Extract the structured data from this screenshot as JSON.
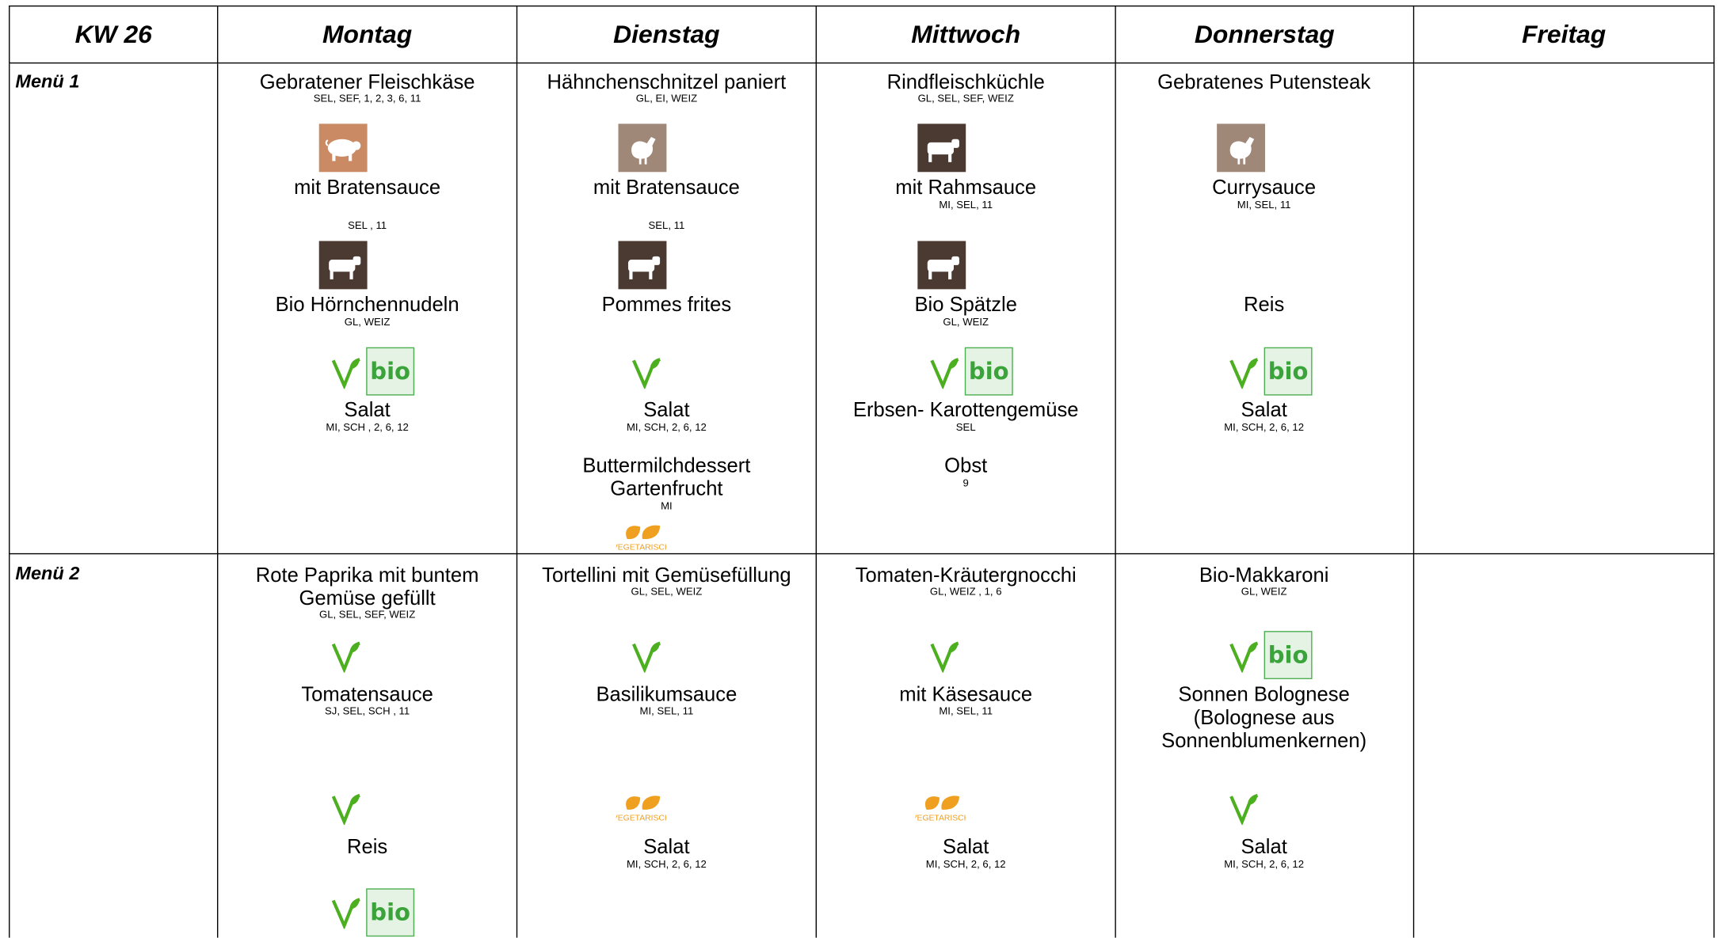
{
  "header": {
    "week": "KW 26",
    "days": [
      "Montag",
      "Dienstag",
      "Mittwoch",
      "Donnerstag",
      "Freitag"
    ]
  },
  "menus": [
    {
      "label": "Menü 1",
      "days": [
        {
          "items": [
            {
              "name": "Gebratener Fleischkäse",
              "allergens": "SEL, SEF, 1, 2, 3, 6, 11"
            },
            {
              "name": "mit Bratensauce",
              "allergens": "SEL , 11"
            },
            {
              "name": "Bio Hörnchennudeln",
              "allergens": "GL, WEIZ"
            },
            {
              "name": "Salat",
              "allergens": "MI, SCH , 2, 6, 12"
            }
          ],
          "icons": [
            "pig-icon",
            "cow-icon",
            "vegan-leaf-icon",
            "bio-badge-icon"
          ]
        },
        {
          "items": [
            {
              "name": "Hähnchenschnitzel paniert",
              "allergens": "GL, EI, WEIZ"
            },
            {
              "name": "mit Bratensauce",
              "allergens": "SEL, 11"
            },
            {
              "name": "Pommes frites",
              "allergens": ""
            },
            {
              "name": "Salat",
              "allergens": "MI, SCH, 2, 6, 12"
            },
            {
              "name": "Buttermilchdessert Gartenfrucht",
              "allergens": "MI"
            }
          ],
          "icons": [
            "chicken-icon",
            "cow-icon",
            "vegan-leaf-icon",
            "vegetarisch-icon"
          ]
        },
        {
          "items": [
            {
              "name": "Rindfleischküchle",
              "allergens": "GL, SEL, SEF, WEIZ"
            },
            {
              "name": "mit Rahmsauce",
              "allergens": "MI, SEL, 11"
            },
            {
              "name": "Bio Spätzle",
              "allergens": "GL, WEIZ"
            },
            {
              "name": "Erbsen- Karottengemüse",
              "allergens": "SEL"
            },
            {
              "name": "Obst",
              "allergens": "9"
            }
          ],
          "icons": [
            "cow-icon",
            "cow-icon",
            "vegan-leaf-icon",
            "bio-badge-icon"
          ]
        },
        {
          "items": [
            {
              "name": "Gebratenes Putensteak",
              "allergens": ""
            },
            {
              "name": "Currysauce",
              "allergens": "MI, SEL, 11"
            },
            {
              "name": "Reis",
              "allergens": ""
            },
            {
              "name": "Salat",
              "allergens": "MI, SCH, 2, 6, 12"
            }
          ],
          "icons": [
            "chicken-icon",
            "vegan-leaf-icon",
            "bio-badge-icon"
          ]
        },
        {
          "items": [],
          "icons": []
        }
      ]
    },
    {
      "label": "Menü 2",
      "days": [
        {
          "items": [
            {
              "name": "Rote Paprika mit buntem Gemüse gefüllt",
              "allergens": "GL, SEL, SEF, WEIZ"
            },
            {
              "name": "Tomatensauce",
              "allergens": "SJ, SEL, SCH , 11"
            },
            {
              "name": "Reis",
              "allergens": ""
            }
          ],
          "icons": [
            "vegan-leaf-icon",
            "vegan-leaf-icon",
            "vegan-leaf-icon",
            "bio-badge-icon"
          ]
        },
        {
          "items": [
            {
              "name": "Tortellini mit Gemüsefüllung",
              "allergens": "GL, SEL, WEIZ"
            },
            {
              "name": "Basilikumsauce",
              "allergens": "MI, SEL, 11"
            },
            {
              "name": "Salat",
              "allergens": "MI, SCH, 2, 6, 12"
            }
          ],
          "icons": [
            "vegan-leaf-icon",
            "vegetarisch-icon"
          ]
        },
        {
          "items": [
            {
              "name": "Tomaten-Kräutergnocchi",
              "allergens": "GL, WEIZ , 1, 6"
            },
            {
              "name": "mit Käsesauce",
              "allergens": "MI, SEL, 11"
            },
            {
              "name": "Salat",
              "allergens": "MI, SCH, 2, 6, 12"
            }
          ],
          "icons": [
            "vegan-leaf-icon",
            "vegetarisch-icon"
          ]
        },
        {
          "items": [
            {
              "name": "Bio-Makkaroni",
              "allergens": "GL, WEIZ"
            },
            {
              "name": "Sonnen Bolognese (Bolognese aus Sonnenblumenkernen)",
              "allergens": ""
            },
            {
              "name": "Salat",
              "allergens": "MI, SCH, 2, 6, 12"
            }
          ],
          "icons": [
            "vegan-leaf-icon",
            "bio-badge-icon",
            "vegan-leaf-icon"
          ]
        },
        {
          "items": [],
          "icons": []
        }
      ]
    }
  ],
  "labels": {
    "bio": "bio",
    "vegetarisch": "VEGETARISCH"
  },
  "colors": {
    "pig": "#c98a64",
    "chicken": "#a08879",
    "cow": "#4b3a31",
    "vegan_leaf": "#4caf1f",
    "bio_green": "#3aa33a",
    "vegetarisch_orange": "#f0a020"
  }
}
